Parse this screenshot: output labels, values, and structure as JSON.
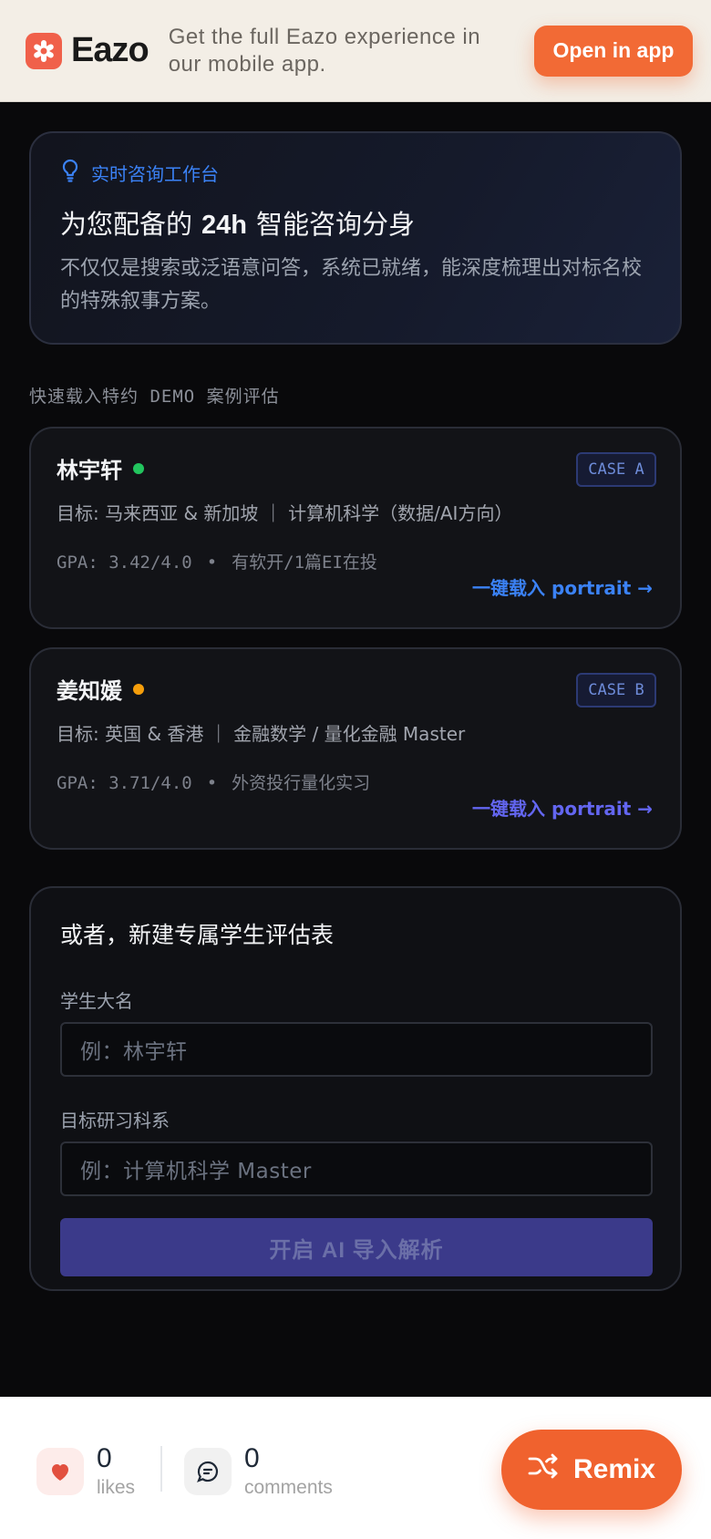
{
  "banner": {
    "brand": "Eazo",
    "message": "Get the full Eazo experience in our mobile app.",
    "open_label": "Open in app"
  },
  "hero": {
    "tag": "实时咨询工作台",
    "title_prefix": "为您配备的",
    "title_highlight": "24h",
    "title_suffix": "智能咨询分身",
    "description": "不仅仅是搜索或泛语意问答，系统已就绪，能深度梳理出对标名校的特殊叙事方案。"
  },
  "section_label": "快速载入特约 DEMO 案例评估",
  "cases": [
    {
      "name": "林宇轩",
      "status_color": "#22c55e",
      "badge": "CASE A",
      "target": "目标: 马来西亚 & 新加坡 ｜ 计算机科学（数据/AI方向）",
      "gpa": "GPA: 3.42/4.0",
      "sep": "•",
      "highlight": "有软开/1篇EI在投",
      "link": "一键载入 portrait →",
      "link_color": "#3b82f6"
    },
    {
      "name": "姜知媛",
      "status_color": "#f59e0b",
      "badge": "CASE B",
      "target": "目标: 英国 & 香港 ｜ 金融数学 / 量化金融 Master",
      "gpa": "GPA: 3.71/4.0",
      "sep": "•",
      "highlight": "外资投行量化实习",
      "link": "一键载入 portrait →",
      "link_color": "#6366f1"
    }
  ],
  "form": {
    "title": "或者，新建专属学生评估表",
    "name_label": "学生大名",
    "name_placeholder": "例：林宇轩",
    "major_label": "目标研习科系",
    "major_placeholder": "例：计算机科学 Master",
    "submit_label": "开启 AI 导入解析"
  },
  "footer": {
    "likes_count": "0",
    "likes_label": "likes",
    "comments_count": "0",
    "comments_label": "comments",
    "remix_label": "Remix"
  }
}
